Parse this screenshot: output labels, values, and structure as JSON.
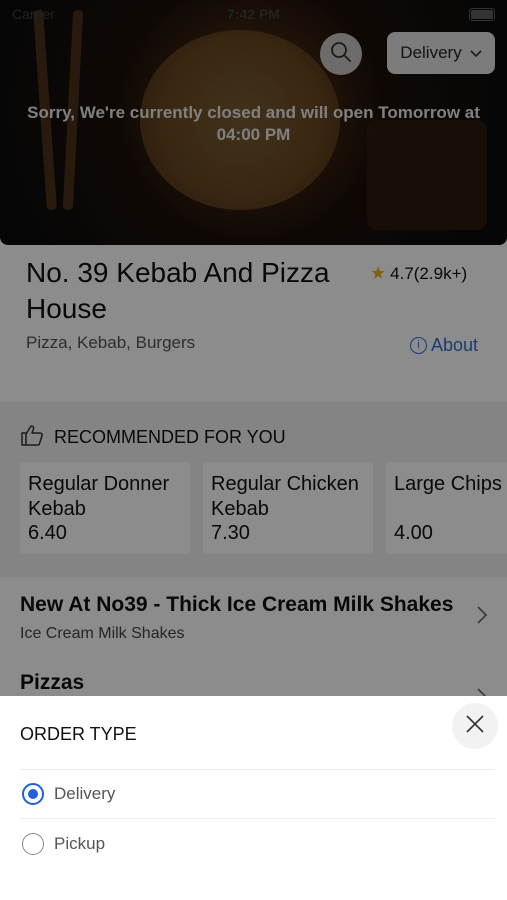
{
  "status_bar": {
    "carrier": "Carrier",
    "time": "7:42 PM"
  },
  "hero": {
    "closed_message_line1": "Sorry, We're currently closed and will open Tomorrow at",
    "closed_message_line2": "04:00 PM",
    "search_icon": "search-icon",
    "order_type_button": "Delivery"
  },
  "restaurant": {
    "name": "No. 39 Kebab And Pizza House",
    "rating": "4.7(2.9k+)",
    "cuisines": "Pizza, Kebab, Burgers",
    "about_label": "About"
  },
  "recommended": {
    "header": "RECOMMENDED FOR YOU",
    "items": [
      {
        "name": "Regular Donner Kebab",
        "price": "6.40"
      },
      {
        "name": "Regular Chicken Kebab",
        "price": "7.30"
      },
      {
        "name": "Large Chips",
        "price": "4.00"
      }
    ]
  },
  "categories": [
    {
      "title": "New At No39 - Thick Ice Cream Milk Shakes",
      "subtitle": "Ice Cream Milk Shakes"
    },
    {
      "title": "Pizzas",
      "subtitle": ""
    }
  ],
  "order_sheet": {
    "title": "ORDER TYPE",
    "options": [
      {
        "label": "Delivery",
        "selected": true
      },
      {
        "label": "Pickup",
        "selected": false
      }
    ]
  },
  "colors": {
    "accent": "#2060d8",
    "link": "#2b6fd6",
    "star": "#f2b01e"
  }
}
